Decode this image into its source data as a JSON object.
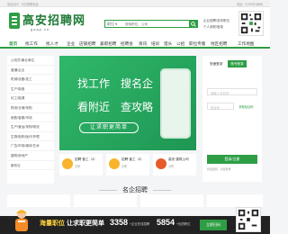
{
  "topbar": {
    "left": "欢迎访问 · 今日招聘信息",
    "right": "电话：07997818888"
  },
  "logo": {
    "name": "高安招聘网",
    "domain": "gaap.cn"
  },
  "search": {
    "scope": "职位 ▾",
    "placeholder": "搜索职位、公司",
    "icon": "search-icon"
  },
  "header_links": [
    "企业招聘/发布职位",
    "个人求职/登录"
  ],
  "nav": {
    "items": [
      "首页",
      "找工作",
      "找人才",
      "企业",
      "店铺招聘",
      "兼职招聘",
      "招聘会",
      "资讯",
      "培训",
      "猎头",
      "公招",
      "职位专版",
      "地区招聘",
      "工作地图"
    ],
    "active_index": 0
  },
  "categories": [
    "公务员/事业单位",
    "普通/企业",
    "机械/设备/技工",
    "生产/制造",
    "化工/能源",
    "物流/仓储/采购",
    "销售/客服/市场",
    "生产/营运/采购/物流",
    "生物/制药/医疗/护理",
    "广告/市场/媒体/艺术",
    "建筑/房地产",
    "服务业"
  ],
  "banner": {
    "lines": [
      "找工作",
      "搜名企",
      "看附近",
      "查攻略"
    ],
    "cta": "让求职更简单"
  },
  "cards": [
    {
      "title": "招聘·普工（4）",
      "tag": "全职"
    },
    {
      "title": "招聘·普工（4）",
      "tag": "全职"
    },
    {
      "title": "高安·建筑公司",
      "tag": "全职"
    }
  ],
  "login": {
    "tabs": [
      "快速登录",
      "账号登录"
    ],
    "active_tab": 1,
    "phone_placeholder": "请输入手机号",
    "code_placeholder": "验证码",
    "send_label": "获取验证码",
    "submit_label": "登录/注册",
    "footer": "找回密码 · 扫码登录"
  },
  "famous": {
    "title": "名企招聘"
  },
  "promo": {
    "headline_a": "海量职位",
    "headline_b": "让求职更简单",
    "stat1_value": "3358",
    "stat1_unit": "+企业在线招聘",
    "stat2_value": "5854",
    "stat2_unit": "+优质职位",
    "cta": "立即扫码"
  },
  "colors": {
    "accent": "#2e9e45",
    "banner": "#30b86a"
  }
}
